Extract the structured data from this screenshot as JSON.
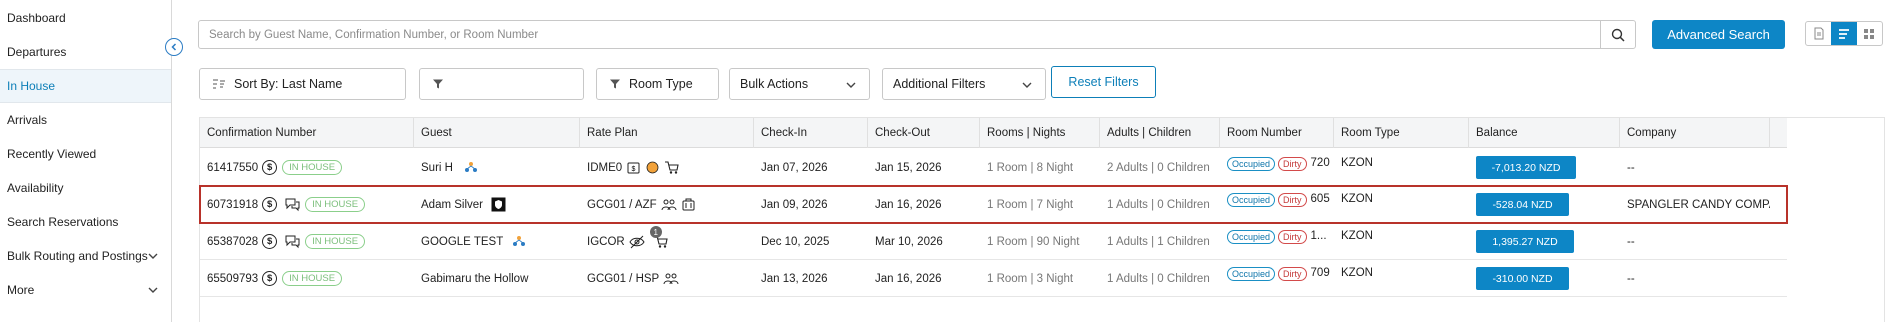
{
  "sidebar": {
    "items": [
      {
        "label": "Dashboard"
      },
      {
        "label": "Departures"
      },
      {
        "label": "In House"
      },
      {
        "label": "Arrivals"
      },
      {
        "label": "Recently Viewed"
      },
      {
        "label": "Availability"
      },
      {
        "label": "Search Reservations"
      },
      {
        "label": "Bulk Routing and Postings"
      },
      {
        "label": "More"
      }
    ],
    "active_index": 2
  },
  "search": {
    "placeholder": "Search by Guest Name, Confirmation Number, or Room Number",
    "value": ""
  },
  "advanced_search_label": "Advanced Search",
  "filters": {
    "sort_label": "Sort By: Last Name",
    "filter_value": "",
    "room_type_label": "Room Type",
    "bulk_actions_label": "Bulk Actions",
    "additional_filters_label": "Additional Filters",
    "reset_label": "Reset Filters"
  },
  "table": {
    "headers": {
      "confirmation": "Confirmation Number",
      "guest": "Guest",
      "rate_plan": "Rate Plan",
      "check_in": "Check-In",
      "check_out": "Check-Out",
      "rooms_nights": "Rooms | Nights",
      "adults_children": "Adults | Children",
      "room_number": "Room Number",
      "room_type": "Room Type",
      "balance": "Balance",
      "company": "Company"
    },
    "rows": [
      {
        "confirmation": "61417550",
        "status": "IN HOUSE",
        "guest": "Suri H",
        "rate_plan": "IDME0",
        "check_in": "Jan 07, 2026",
        "check_out": "Jan 15, 2026",
        "rooms_nights": "1 Room | 8 Night",
        "adults_children": "2 Adults | 0 Children",
        "occupied": "Occupied",
        "dirty": "Dirty",
        "room_number": "720",
        "room_type": "KZON",
        "balance": "-7,013.20 NZD",
        "company": "--"
      },
      {
        "confirmation": "60731918",
        "status": "IN HOUSE",
        "guest": "Adam Silver",
        "rate_plan": "GCG01 / AZF",
        "check_in": "Jan 09, 2026",
        "check_out": "Jan 16, 2026",
        "rooms_nights": "1 Room | 7 Night",
        "adults_children": "1 Adults | 0 Children",
        "occupied": "Occupied",
        "dirty": "Dirty",
        "room_number": "605",
        "room_type": "KZON",
        "balance": "-528.04 NZD",
        "company": "SPANGLER CANDY COMPANY"
      },
      {
        "confirmation": "65387028",
        "status": "IN HOUSE",
        "guest": "GOOGLE TEST",
        "rate_plan": "IGCOR",
        "check_in": "Dec 10, 2025",
        "check_out": "Mar 10, 2026",
        "rooms_nights": "1 Room | 90 Night",
        "adults_children": "1 Adults | 1 Children",
        "occupied": "Occupied",
        "dirty": "Dirty",
        "room_number": "1...",
        "room_type": "KZON",
        "balance": "1,395.27 NZD",
        "company": "--",
        "rate_badge_count": "1"
      },
      {
        "confirmation": "65509793",
        "status": "IN HOUSE",
        "guest": "Gabimaru the Hollow",
        "rate_plan": "GCG01 / HSP",
        "check_in": "Jan 13, 2026",
        "check_out": "Jan 16, 2026",
        "rooms_nights": "1 Room | 3 Night",
        "adults_children": "1 Adults | 0 Children",
        "occupied": "Occupied",
        "dirty": "Dirty",
        "room_number": "709",
        "room_type": "KZON",
        "balance": "-310.00 NZD",
        "company": "--"
      }
    ],
    "selected_row": 1
  },
  "colors": {
    "accent": "#0d86c6",
    "selected_outline": "#b8322a",
    "in_house_green": "#7cbf7c",
    "dirty_red": "#c43a3a"
  },
  "icons": [
    "chevron-left-icon",
    "search-icon",
    "list-view-icon",
    "grid-view-icon",
    "sort-icon",
    "filter-icon",
    "chevron-down-icon",
    "dollar-icon",
    "message-icon",
    "kebab-icon"
  ]
}
